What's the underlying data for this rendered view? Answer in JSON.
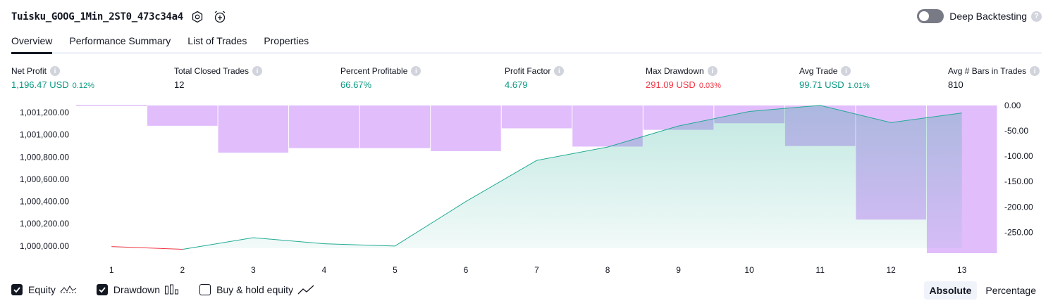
{
  "header": {
    "strategy_name": "Tuisku_GOOG_1Min_2ST0_473c34a4",
    "settings_icon": "gear-icon",
    "alert_icon": "alarm-plus-icon",
    "deep_backtesting_label": "Deep Backtesting",
    "deep_backtesting_enabled": false,
    "help_glyph": "?"
  },
  "tabs": [
    {
      "label": "Overview",
      "active": true
    },
    {
      "label": "Performance Summary",
      "active": false
    },
    {
      "label": "List of Trades",
      "active": false
    },
    {
      "label": "Properties",
      "active": false
    }
  ],
  "stats": [
    {
      "label": "Net Profit",
      "value": "1,196.47 USD",
      "sub": "0.12%",
      "color": "green"
    },
    {
      "label": "Total Closed Trades",
      "value": "12",
      "sub": "",
      "color": "dark"
    },
    {
      "label": "Percent Profitable",
      "value": "66.67%",
      "sub": "",
      "color": "green"
    },
    {
      "label": "Profit Factor",
      "value": "4.679",
      "sub": "",
      "color": "green"
    },
    {
      "label": "Max Drawdown",
      "value": "291.09 USD",
      "sub": "0.03%",
      "color": "red"
    },
    {
      "label": "Avg Trade",
      "value": "99.71 USD",
      "sub": "1.01%",
      "color": "green"
    },
    {
      "label": "Avg # Bars in Trades",
      "value": "810",
      "sub": "",
      "color": "dark"
    }
  ],
  "info_glyph": "i",
  "legend": {
    "equity": {
      "label": "Equity",
      "checked": true
    },
    "drawdown": {
      "label": "Drawdown",
      "checked": true
    },
    "buy_hold": {
      "label": "Buy & hold equity",
      "checked": false
    }
  },
  "mode": {
    "absolute": "Absolute",
    "percentage": "Percentage",
    "active": "absolute"
  },
  "colors": {
    "equity_up": "#22ab94",
    "equity_down": "#f23645",
    "drawdown": "#e1bdfc",
    "area": "#d4f1ea"
  },
  "chart_data": {
    "type": "area",
    "x": [
      1,
      2,
      3,
      4,
      5,
      6,
      7,
      8,
      9,
      10,
      11,
      12,
      13
    ],
    "series": [
      {
        "name": "Equity",
        "values": [
          999995,
          999970,
          1000075,
          1000020,
          1000000,
          1000400,
          1000770,
          1000890,
          1001080,
          1001210,
          1001265,
          1001110,
          1001196.47
        ]
      },
      {
        "name": "Drawdown",
        "values": [
          0,
          -40,
          -93,
          -84,
          -84,
          -90,
          -45,
          -81,
          -48,
          -35,
          -80,
          -225,
          -291.09
        ]
      }
    ],
    "y_left_ticks": [
      "1,000,000.00",
      "1,000,200.00",
      "1,000,400.00",
      "1,000,600.00",
      "1,000,800.00",
      "1,001,000.00",
      "1,001,200.00"
    ],
    "y_left_lim": [
      999980,
      1001264
    ],
    "y_right_ticks": [
      "0.00",
      "-50.00",
      "-100.00",
      "-150.00",
      "-200.00",
      "-250.00"
    ],
    "y_right_lim": [
      -291.09,
      0
    ],
    "xlabel": "",
    "ylabel": ""
  }
}
